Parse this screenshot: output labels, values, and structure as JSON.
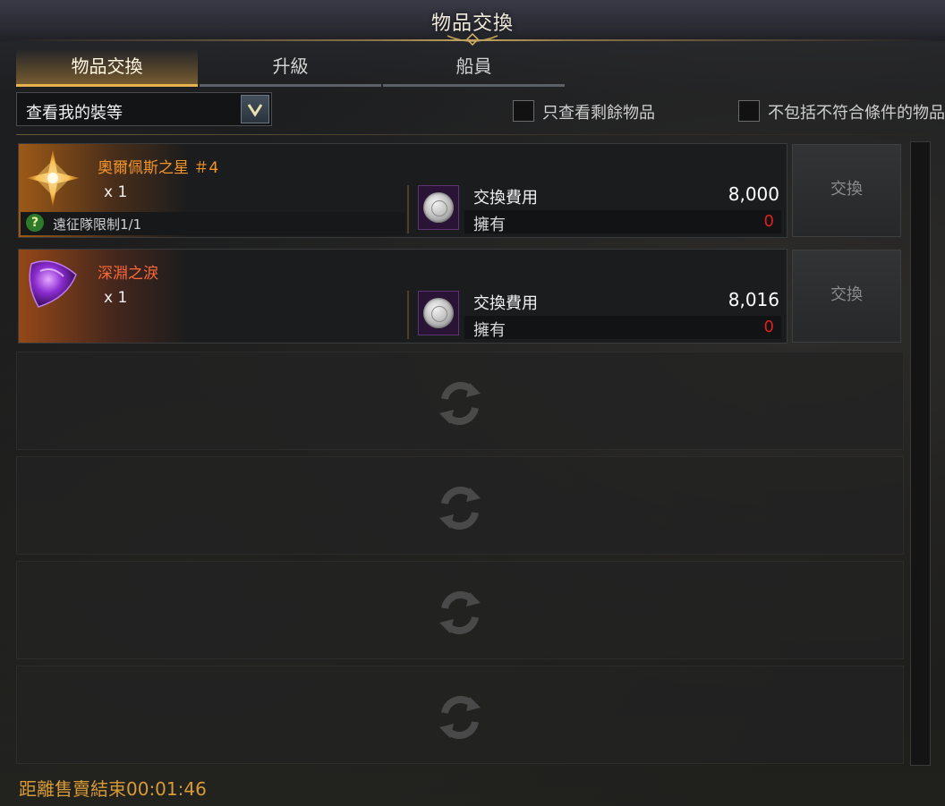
{
  "window": {
    "title": "物品交換"
  },
  "tabs": [
    {
      "label": "物品交換",
      "active": true
    },
    {
      "label": "升級",
      "active": false
    },
    {
      "label": "船員",
      "active": false
    }
  ],
  "filter": {
    "dropdown_value": "查看我的裝等",
    "checkbox_remaining": {
      "label": "只查看剩餘物品",
      "checked": false
    },
    "checkbox_exclude": {
      "label": "不包括不符合條件的物品",
      "checked": false
    }
  },
  "items": [
    {
      "name": "奧爾佩斯之星 ＃4",
      "qty": "x 1",
      "limit_text": "遠征隊限制1/1",
      "limit_icon": "question-icon",
      "cost_label": "交換費用",
      "cost_value": "8,000",
      "own_label": "擁有",
      "own_value": "0",
      "button_label": "交換",
      "icon": "star-icon"
    },
    {
      "name": "深淵之淚",
      "qty": "x 1",
      "cost_label": "交換費用",
      "cost_value": "8,016",
      "own_label": "擁有",
      "own_value": "0",
      "button_label": "交換",
      "icon": "purple-gem-icon"
    }
  ],
  "empty_slots": 4,
  "footer": {
    "timer_text": "距離售賣結束00:01:46"
  },
  "colors": {
    "accent_gold": "#e8b250",
    "item_name_orange": "#f2952b",
    "item_name_red": "#ff6a3a",
    "own_zero_red": "#e0201c",
    "footer_gold": "#d99b36"
  }
}
